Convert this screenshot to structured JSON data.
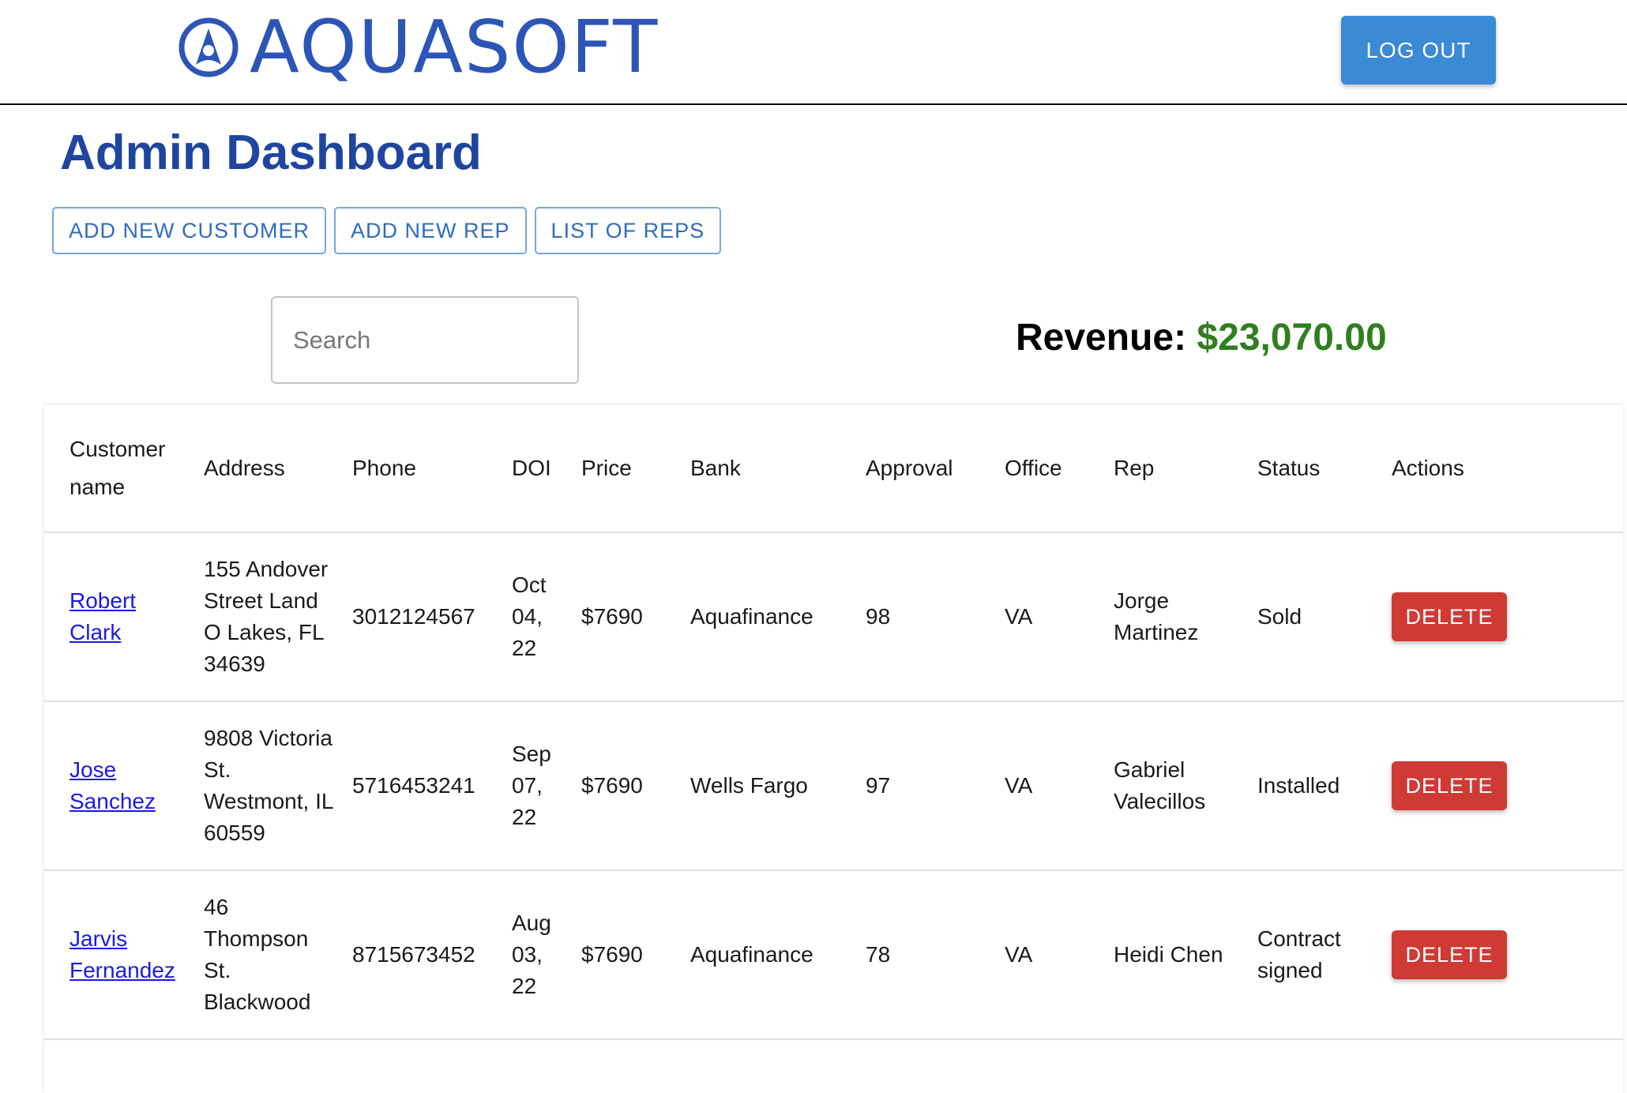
{
  "header": {
    "brand": "AQUASOFT",
    "logout_label": "LOG OUT",
    "brand_color": "#2c55b8"
  },
  "page": {
    "title": "Admin Dashboard"
  },
  "actions": {
    "add_customer_label": "ADD NEW CUSTOMER",
    "add_rep_label": "ADD NEW REP",
    "list_reps_label": "LIST OF REPS"
  },
  "search": {
    "placeholder": "Search",
    "value": ""
  },
  "revenue": {
    "label": "Revenue:",
    "value": "$23,070.00",
    "color": "#2f7f1e"
  },
  "table": {
    "columns": [
      "Customer name",
      "Address",
      "Phone",
      "DOI",
      "Price",
      "Bank",
      "Approval",
      "Office",
      "Rep",
      "Status",
      "Actions"
    ],
    "rows": [
      {
        "name": "Robert Clark",
        "address": "155 Andover Street Land O Lakes, FL 34639",
        "phone": "3012124567",
        "doi": "Oct 04, 22",
        "price": "$7690",
        "bank": "Aquafinance",
        "approval": "98",
        "office": "VA",
        "rep": "Jorge Martinez",
        "status": "Sold",
        "action_label": "DELETE"
      },
      {
        "name": "Jose Sanchez",
        "address": "9808 Victoria St. Westmont, IL 60559",
        "phone": "5716453241",
        "doi": "Sep 07, 22",
        "price": "$7690",
        "bank": "Wells Fargo",
        "approval": "97",
        "office": "VA",
        "rep": "Gabriel Valecillos",
        "status": "Installed",
        "action_label": "DELETE"
      },
      {
        "name": "Jarvis Fernandez",
        "address": "46 Thompson St. Blackwood",
        "phone": "8715673452",
        "doi": "Aug 03, 22",
        "price": "$7690",
        "bank": "Aquafinance",
        "approval": "78",
        "office": "VA",
        "rep": "Heidi Chen",
        "status": "Contract signed",
        "action_label": "DELETE"
      }
    ]
  }
}
